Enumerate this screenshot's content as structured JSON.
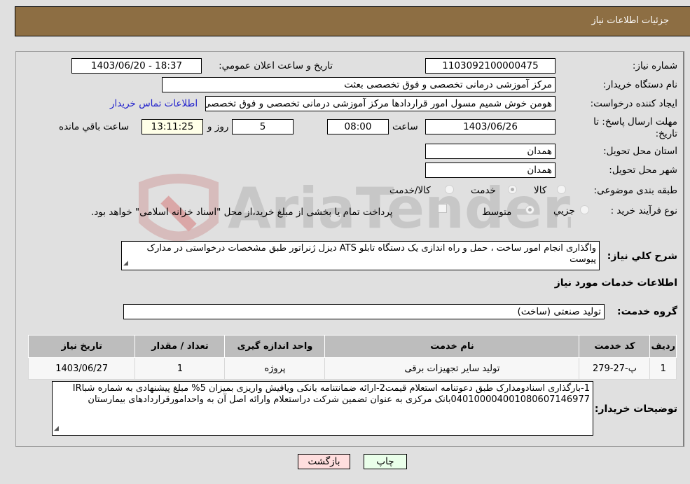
{
  "header": {
    "title": "جزئيات اطلاعات نياز"
  },
  "form": {
    "need_number": {
      "label": "شماره نياز:",
      "value": "1103092100000475"
    },
    "announce_datetime": {
      "label": "تاريخ و ساعت اعلان عمومي:",
      "value": "1403/06/20 - 18:37"
    },
    "buyer_org": {
      "label": "نام دستگاه خريدار:",
      "value": "مرکز آموزشی درمانی تخصصی و فوق تخصصی بعثت"
    },
    "requester": {
      "label": "ايجاد کننده درخواست:",
      "value": "هومن خوش شمیم مسول امور قراردادها مرکز آموزشی درمانی تخصصی و فوق تخصصی بعثت"
    },
    "buyer_contact_link": "اطلاعات تماس خريدار",
    "deadline": {
      "label_line1": "مهلت ارسال پاسخ: تا",
      "label_line2": "تاريخ:",
      "date": "1403/06/26",
      "time_label": "ساعت",
      "time": "08:00",
      "days": "5",
      "days_label": "روز و",
      "remaining": "13:11:25",
      "remaining_label": "ساعت باقي مانده"
    },
    "province": {
      "label": "استان محل تحويل:",
      "value": "همدان"
    },
    "city": {
      "label": "شهر محل تحويل:",
      "value": "همدان"
    },
    "category": {
      "label": "طبقه بندی موضوعی:",
      "options": [
        "کالا",
        "خدمت",
        "کالا/خدمت"
      ],
      "selected": "خدمت"
    },
    "purchase_type": {
      "label": "نوع فرآيند خريد :",
      "options": [
        "جزيي",
        "متوسط"
      ],
      "selected": "متوسط",
      "treasury_note": "پرداخت تمام يا بخشی از مبلغ خريد،از محل \"اسناد خزانه اسلامی\" خواهد بود."
    },
    "description": {
      "label": "شرح کلي نياز:",
      "value": "واگذاری انجام امور ساخت ، حمل و راه اندازی یک دستگاه تابلو ATS دیزل ژنراتور طبق مشخصات درخواستی در مدارک پیوست"
    }
  },
  "services_section": {
    "title": "اطلاعات خدمات مورد نياز",
    "group_label": "گروه خدمت:",
    "group_value": "تولید صنعتی (ساخت)",
    "table": {
      "headers": [
        "رديف",
        "کد خدمت",
        "نام خدمت",
        "واحد اندازه گيری",
        "تعداد / مقدار",
        "تاريخ نياز"
      ],
      "rows": [
        [
          "1",
          "پ-27-279",
          "تولید سایر تجهیزات برقی",
          "پروژه",
          "1",
          "1403/06/27"
        ]
      ]
    }
  },
  "buyer_notes": {
    "label": "توضيحات خريدار:",
    "value": "1-بارگذاری اسنادومدارک طبق دعوتنامه استعلام قیمت2-ارائه ضمانتنامه بانکی ویافیش واریزی بمیزان 5% مبلغ پیشنهادی به شماره شباIR 040100004001080607146977بانک  مرکزی به عنوان تضمین شرکت دراستعلام وارائه اصل آن به واحدامورقراردادهای بیمارستان"
  },
  "buttons": {
    "print": "چاپ",
    "back": "بازگشت"
  },
  "colors": {
    "header_bg": "#8d6e43",
    "link": "#2222cc",
    "print_bg": "#eaffea",
    "back_bg": "#ffdede"
  }
}
